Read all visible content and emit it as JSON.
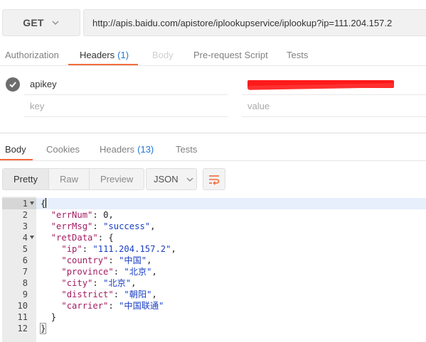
{
  "request": {
    "method": "GET",
    "url": "http://apis.baidu.com/apistore/iplookupservice/iplookup?ip=111.204.157.2"
  },
  "request_tabs": [
    {
      "label": "Authorization",
      "count": "",
      "state": "normal"
    },
    {
      "label": "Headers",
      "count": "(1)",
      "state": "active"
    },
    {
      "label": "Body",
      "count": "",
      "state": "disabled"
    },
    {
      "label": "Pre-request Script",
      "count": "",
      "state": "normal"
    },
    {
      "label": "Tests",
      "count": "",
      "state": "normal"
    }
  ],
  "headers": {
    "rows": [
      {
        "key": "apikey",
        "value": "",
        "enabled": true,
        "value_redacted": true
      }
    ],
    "new_row": {
      "key_placeholder": "key",
      "value_placeholder": "value"
    }
  },
  "response_tabs": [
    {
      "label": "Body",
      "count": "",
      "state": "active"
    },
    {
      "label": "Cookies",
      "count": "",
      "state": "normal"
    },
    {
      "label": "Headers",
      "count": "(13)",
      "state": "normal"
    },
    {
      "label": "Tests",
      "count": "",
      "state": "normal"
    }
  ],
  "view_modes": [
    "Pretty",
    "Raw",
    "Preview"
  ],
  "active_view_mode": "Pretty",
  "format": "JSON",
  "code_lines": [
    {
      "n": "1",
      "fold": true
    },
    {
      "n": "2",
      "fold": false
    },
    {
      "n": "3",
      "fold": false
    },
    {
      "n": "4",
      "fold": true
    },
    {
      "n": "5",
      "fold": false
    },
    {
      "n": "6",
      "fold": false
    },
    {
      "n": "7",
      "fold": false
    },
    {
      "n": "8",
      "fold": false
    },
    {
      "n": "9",
      "fold": false
    },
    {
      "n": "10",
      "fold": false
    },
    {
      "n": "11",
      "fold": false
    },
    {
      "n": "12",
      "fold": false
    }
  ],
  "response_json": {
    "errNum": "0",
    "errMsg": "\"success\"",
    "retData": {
      "ip": "\"111.204.157.2\"",
      "country": "\"中国\"",
      "province": "\"北京\"",
      "city": "\"北京\"",
      "district": "\"朝阳\"",
      "carrier": "\"中国联通\""
    }
  },
  "colors": {
    "accent": "#f26b3a",
    "count_blue": "#2176d2",
    "json_key": "#a31c62",
    "json_string": "#1a3fc4",
    "redaction": "#ff1a1a"
  },
  "icons": {
    "method_dropdown": "chevron-down-icon",
    "format_dropdown": "chevron-down-icon",
    "header_enabled": "checkmark-icon",
    "wrap": "wrap-lines-icon"
  }
}
